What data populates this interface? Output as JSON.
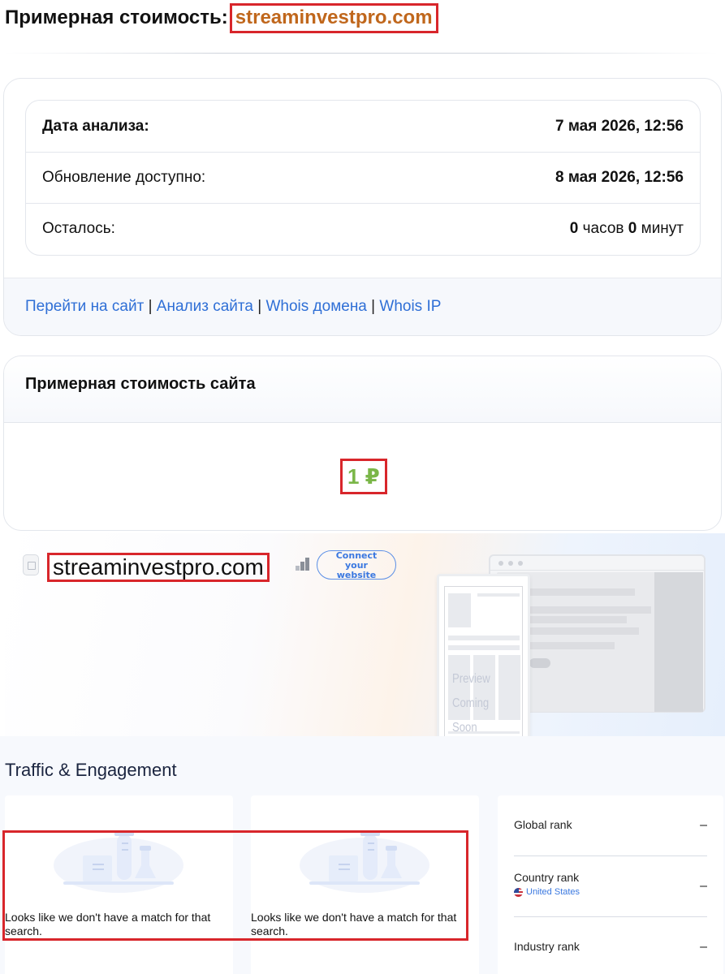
{
  "header": {
    "title_prefix": "Примерная стоимость:",
    "domain": "streaminvestpro.com"
  },
  "analysis": {
    "rows": [
      {
        "label": "Дата анализа:",
        "value": "7 мая 2026, 12:56"
      },
      {
        "label": "Обновление доступно:",
        "value": "8 мая 2026, 12:56"
      },
      {
        "label": "Осталось:",
        "hours": "0",
        "hours_unit": "часов",
        "minutes": "0",
        "minutes_unit": "минут"
      }
    ],
    "links": [
      "Перейти на сайт",
      "Анализ сайта",
      "Whois домена",
      "Whois IP"
    ],
    "separator": "|"
  },
  "estimate": {
    "heading": "Примерная стоимость сайта",
    "value": "1 ₽",
    "value_color": "#7ab648"
  },
  "similarweb": {
    "domain": "streaminvestpro.com",
    "connect_button": "Connect your website",
    "preview_text_1": "Preview",
    "preview_text_2": "Coming Soon",
    "section_title": "Traffic & Engagement",
    "no_match_message": "Looks like we don't have a match for that search.",
    "ranks": [
      {
        "label": "Global rank",
        "value": "–"
      },
      {
        "label": "Country rank",
        "value": "–",
        "country": "United States"
      },
      {
        "label": "Industry rank",
        "value": "–"
      }
    ]
  },
  "colors": {
    "accent_link": "#2f6fd6",
    "domain_orange": "#c0671c",
    "highlight_red": "#d8262b"
  }
}
